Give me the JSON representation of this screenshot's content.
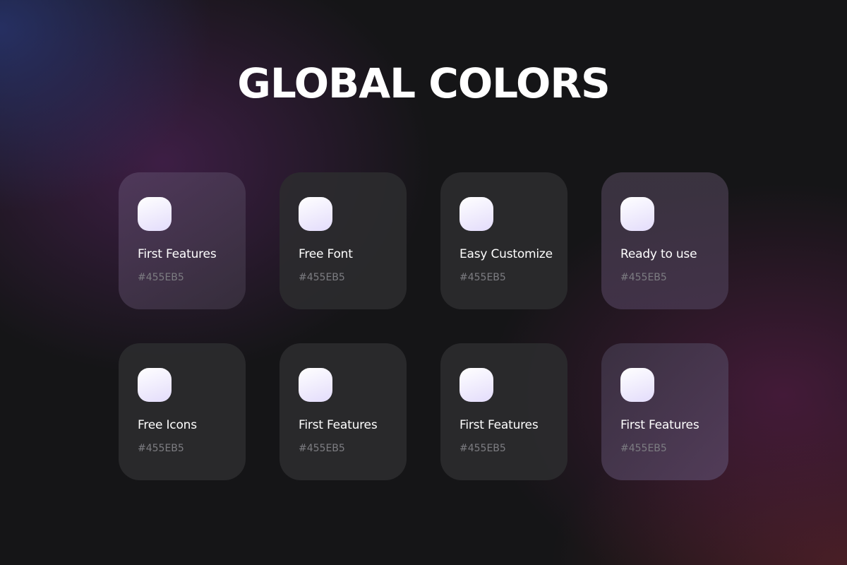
{
  "page": {
    "title": "GLOBAL COLORS"
  },
  "colors": {
    "background": "#151517",
    "card": "#2C2C2F",
    "swatch_start": "#FFFFFF",
    "swatch_end": "#E3DCFB",
    "label": "#FFFFFF",
    "hex_text": "#7D7D82"
  },
  "cards": [
    {
      "label": "First  Features",
      "hex": "#455EB5"
    },
    {
      "label": "Free Font",
      "hex": "#455EB5"
    },
    {
      "label": "Easy Customize",
      "hex": "#455EB5"
    },
    {
      "label": "Ready to use",
      "hex": "#455EB5"
    },
    {
      "label": "Free Icons",
      "hex": "#455EB5"
    },
    {
      "label": "First  Features",
      "hex": "#455EB5"
    },
    {
      "label": "First  Features",
      "hex": "#455EB5"
    },
    {
      "label": "First  Features",
      "hex": "#455EB5"
    }
  ]
}
